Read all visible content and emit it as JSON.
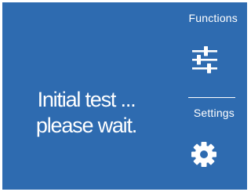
{
  "screen": {
    "message_line1": "Initial test ...",
    "message_line2": "please wait."
  },
  "menu": {
    "functions_label": "Functions",
    "functions_icon": "sliders-icon",
    "settings_label": "Settings",
    "settings_icon": "gear-icon"
  },
  "colors": {
    "background": "#2e6bb0",
    "foreground": "#ffffff"
  }
}
